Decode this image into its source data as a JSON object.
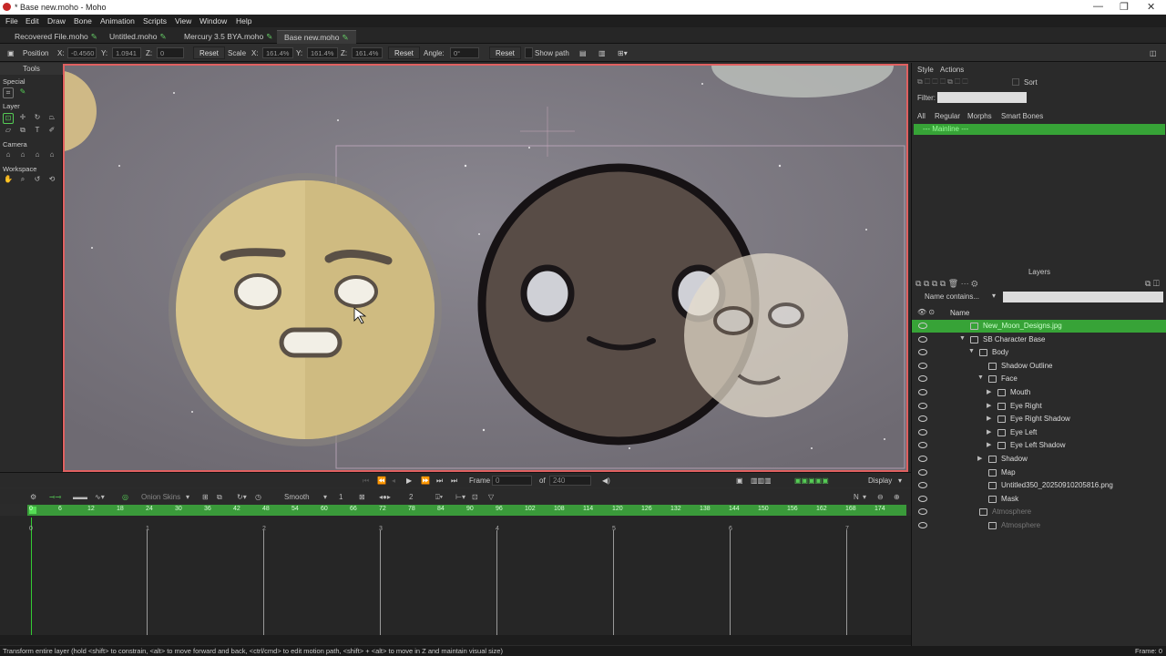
{
  "window": {
    "title": "* Base new.moho - Moho"
  },
  "menu": [
    "File",
    "Edit",
    "Draw",
    "Bone",
    "Animation",
    "Scripts",
    "View",
    "Window",
    "Help"
  ],
  "tabs": [
    {
      "label": "Recovered File.moho"
    },
    {
      "label": "Untitled.moho"
    },
    {
      "label": "Mercury 3.5 BYA.moho"
    },
    {
      "label": "Base new.moho",
      "active": true
    }
  ],
  "options": {
    "position_label": "Position",
    "x_label": "X:",
    "x_value": "-0.4560",
    "y_label": "Y:",
    "y_value": "1.0941",
    "z_label": "Z:",
    "z_value": "0",
    "reset1": "Reset",
    "scale_label": "Scale",
    "sx_label": "X:",
    "sx_value": "161.4%",
    "sy_label": "Y:",
    "sy_value": "161.4%",
    "sz_label": "Z:",
    "sz_value": "161.4%",
    "reset2": "Reset",
    "angle_label": "Angle:",
    "angle_value": "0°",
    "reset3": "Reset",
    "show_path": "Show path"
  },
  "tools": {
    "title": "Tools",
    "sections": [
      "Special",
      "Layer",
      "Camera",
      "Workspace"
    ]
  },
  "playbar": {
    "frame_label": "Frame",
    "frame_value": "0",
    "of_label": "of",
    "total": "240",
    "display": "Display"
  },
  "timeline": {
    "onion": "Onion Skins",
    "interp": "Smooth",
    "interp_num": "1",
    "keys_num": "2",
    "n_label": "N",
    "ruler": [
      "0",
      "6",
      "12",
      "18",
      "24",
      "30",
      "36",
      "42",
      "48",
      "54",
      "60",
      "66",
      "72",
      "78",
      "84",
      "90",
      "96",
      "102",
      "108",
      "114",
      "120",
      "126",
      "132",
      "138",
      "144",
      "150",
      "156",
      "162",
      "168",
      "174"
    ],
    "seconds": [
      "0",
      "1",
      "2",
      "3",
      "4",
      "5",
      "6",
      "7"
    ]
  },
  "status": {
    "hint": "Transform entire layer (hold <shift> to constrain, <alt> to move forward and back, <ctrl/cmd> to edit motion path, <shift> + <alt> to move in Z and maintain visual size)",
    "frame": "Frame: 0"
  },
  "style_panel": {
    "tab_style": "Style",
    "tab_actions": "Actions",
    "sort": "Sort",
    "filter_label": "Filter:",
    "filters": [
      "All",
      "Regular",
      "Morphs",
      "Smart Bones"
    ],
    "mainline": "--- Mainline ---"
  },
  "layers_panel": {
    "title": "Layers",
    "filter_select": "Name contains...",
    "name_col": "Name",
    "layers": [
      {
        "name": "New_Moon_Designs.jpg",
        "depth": 0,
        "selected": true
      },
      {
        "name": "SB Character Base",
        "depth": 0,
        "open": true
      },
      {
        "name": "Body",
        "depth": 1,
        "open": true
      },
      {
        "name": "Shadow Outline",
        "depth": 2
      },
      {
        "name": "Face",
        "depth": 2,
        "open": true
      },
      {
        "name": "Mouth",
        "depth": 3
      },
      {
        "name": "Eye Right",
        "depth": 3
      },
      {
        "name": "Eye Right Shadow",
        "depth": 3
      },
      {
        "name": "Eye Left",
        "depth": 3
      },
      {
        "name": "Eye Left Shadow",
        "depth": 3
      },
      {
        "name": "Shadow",
        "depth": 2
      },
      {
        "name": "Map",
        "depth": 2
      },
      {
        "name": "Untitled350_20250910205816.png",
        "depth": 2
      },
      {
        "name": "Mask",
        "depth": 2
      },
      {
        "name": "Atmosphere",
        "depth": 1,
        "dim": true
      },
      {
        "name": "Atmosphere",
        "depth": 2,
        "dim": true
      }
    ]
  }
}
